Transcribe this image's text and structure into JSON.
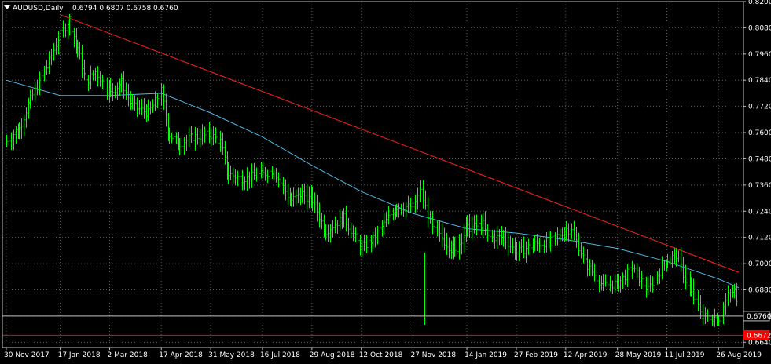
{
  "window": {
    "title": "AUDUSD,Daily",
    "ohlc": "0.6794 0.6807 0.6758 0.6760"
  },
  "colors": {
    "background": "#000000",
    "grid": "#5c5c5c",
    "frame": "#c0c0c0",
    "text": "#ffffff",
    "candle": "#00ff00",
    "moving_average": "#4fb6e6",
    "trendline": "#ff2020",
    "support": "#ff0000",
    "bid_line": "#c0c0c0"
  },
  "chart_data": {
    "type": "line",
    "symbol": "AUDUSD",
    "timeframe": "Daily",
    "chart_style": "bars",
    "grid": true,
    "y_axis_side": "right",
    "ylim": [
      0.6616,
      0.82
    ],
    "y_ticks": [
      "0.8200",
      "0.8080",
      "0.7960",
      "0.7840",
      "0.7720",
      "0.7600",
      "0.7480",
      "0.7360",
      "0.7240",
      "0.7120",
      "0.7000",
      "0.6880",
      "0.6760",
      "0.6640"
    ],
    "x_ticks": [
      "30 Nov 2017",
      "17 Jan 2018",
      "2 Mar 2018",
      "17 Apr 2018",
      "31 May 2018",
      "16 Jul 2018",
      "29 Aug 2018",
      "12 Oct 2018",
      "27 Nov 2018",
      "14 Jan 2019",
      "27 Feb 2019",
      "12 Apr 2019",
      "28 May 2019",
      "11 Jul 2019",
      "26 Aug 2019"
    ],
    "price_series": {
      "dates": [
        "30 Nov 2017",
        "11 Dec 2017",
        "21 Dec 2017",
        "5 Jan 2018",
        "17 Jan 2018",
        "25 Jan 2018",
        "1 Feb 2018",
        "9 Feb 2018",
        "17 Feb 2018",
        "2 Mar 2018",
        "12 Mar 2018",
        "22 Mar 2018",
        "5 Apr 2018",
        "17 Apr 2018",
        "24 Apr 2018",
        "3 May 2018",
        "15 May 2018",
        "31 May 2018",
        "8 Jun 2018",
        "15 Jun 2018",
        "28 Jun 2018",
        "16 Jul 2018",
        "26 Jul 2018",
        "10 Aug 2018",
        "20 Aug 2018",
        "29 Aug 2018",
        "10 Sep 2018",
        "26 Sep 2018",
        "12 Oct 2018",
        "22 Oct 2018",
        "1 Nov 2018",
        "12 Nov 2018",
        "27 Nov 2018",
        "4 Dec 2018",
        "14 Dec 2018",
        "3 Jan 2019",
        "14 Jan 2019",
        "28 Jan 2019",
        "1 Feb 2019",
        "15 Feb 2019",
        "27 Feb 2019",
        "15 Mar 2019",
        "29 Mar 2019",
        "12 Apr 2019",
        "17 Apr 2019",
        "1 May 2019",
        "15 May 2019",
        "28 May 2019",
        "10 Jun 2019",
        "24 Jun 2019",
        "11 Jul 2019",
        "19 Jul 2019",
        "1 Aug 2019",
        "12 Aug 2019",
        "26 Aug 2019",
        "3 Sep 2019",
        "9 Sep 2019",
        "13 Sep 2019"
      ],
      "close": [
        0.756,
        0.762,
        0.775,
        0.79,
        0.805,
        0.812,
        0.799,
        0.783,
        0.788,
        0.778,
        0.783,
        0.772,
        0.769,
        0.779,
        0.759,
        0.755,
        0.758,
        0.759,
        0.756,
        0.741,
        0.739,
        0.741,
        0.743,
        0.729,
        0.732,
        0.729,
        0.715,
        0.721,
        0.707,
        0.711,
        0.718,
        0.726,
        0.726,
        0.733,
        0.716,
        0.705,
        0.716,
        0.718,
        0.712,
        0.712,
        0.705,
        0.709,
        0.71,
        0.716,
        0.715,
        0.699,
        0.69,
        0.691,
        0.698,
        0.688,
        0.702,
        0.704,
        0.686,
        0.676,
        0.675,
        0.685,
        0.688,
        0.676
      ],
      "high": [
        0.761,
        0.766,
        0.78,
        0.796,
        0.812,
        0.814,
        0.805,
        0.79,
        0.792,
        0.79,
        0.787,
        0.778,
        0.777,
        0.781,
        0.765,
        0.76,
        0.764,
        0.768,
        0.761,
        0.749,
        0.744,
        0.748,
        0.747,
        0.736,
        0.74,
        0.738,
        0.72,
        0.728,
        0.712,
        0.716,
        0.724,
        0.732,
        0.73,
        0.739,
        0.724,
        0.717,
        0.728,
        0.724,
        0.719,
        0.72,
        0.714,
        0.715,
        0.715,
        0.72,
        0.72,
        0.706,
        0.695,
        0.697,
        0.702,
        0.695,
        0.706,
        0.708,
        0.7,
        0.681,
        0.68,
        0.69,
        0.69,
        0.681
      ],
      "low": [
        0.749,
        0.753,
        0.769,
        0.785,
        0.8,
        0.804,
        0.791,
        0.776,
        0.781,
        0.772,
        0.776,
        0.768,
        0.764,
        0.769,
        0.753,
        0.749,
        0.751,
        0.754,
        0.747,
        0.735,
        0.732,
        0.736,
        0.737,
        0.722,
        0.724,
        0.72,
        0.709,
        0.715,
        0.702,
        0.705,
        0.712,
        0.72,
        0.72,
        0.727,
        0.71,
        0.699,
        0.708,
        0.711,
        0.706,
        0.705,
        0.7,
        0.702,
        0.704,
        0.71,
        0.708,
        0.695,
        0.686,
        0.686,
        0.693,
        0.682,
        0.697,
        0.699,
        0.681,
        0.67,
        0.67,
        0.679,
        0.684,
        0.674
      ]
    },
    "moving_average": {
      "dates": [
        "30 Nov 2017",
        "17 Jan 2018",
        "2 Mar 2018",
        "17 Apr 2018",
        "31 May 2018",
        "16 Jul 2018",
        "29 Aug 2018",
        "12 Oct 2018",
        "27 Nov 2018",
        "14 Jan 2019",
        "27 Feb 2019",
        "12 Apr 2019",
        "28 May 2019",
        "11 Jul 2019",
        "26 Aug 2019",
        "13 Sep 2019"
      ],
      "values": [
        0.784,
        0.777,
        0.777,
        0.778,
        0.769,
        0.758,
        0.745,
        0.733,
        0.723,
        0.716,
        0.714,
        0.711,
        0.707,
        0.701,
        0.693,
        0.689
      ]
    },
    "trendline": {
      "start": {
        "date": "17 Jan 2018",
        "price": 0.814
      },
      "end": {
        "date": "13 Sep 2019",
        "price": 0.696
      }
    },
    "horizontal_lines": [
      {
        "name": "bid",
        "price": 0.676,
        "label": "0.6760"
      },
      {
        "name": "support",
        "price": 0.6672,
        "label": "0.6672"
      }
    ]
  }
}
